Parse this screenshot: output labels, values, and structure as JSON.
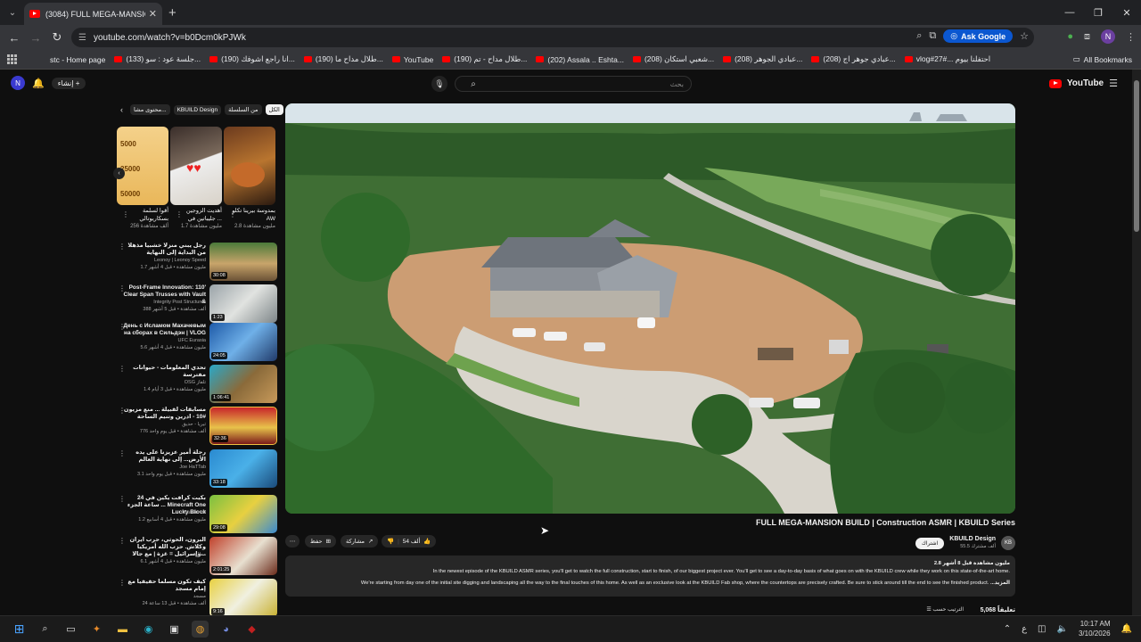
{
  "browser": {
    "tab_title": "(3084) FULL MEGA-MANSION B",
    "url": "youtube.com/watch?v=b0Dcm0kPJWk",
    "ask_google": "Ask Google",
    "profile_initial": "N"
  },
  "bookmarks": {
    "items": [
      "stc - Home page",
      "(133) جلسة عود : سو...",
      "(190) انا راجع اشوفك...",
      "(190) طلال مداح ما...",
      "YouTube",
      "(190) طلال مداح - تم...",
      "(202) Assala .. Eshta...",
      "(208) شعبي استكان...",
      "(208) عبادي الجوهر...",
      "(208) عبادي جوهر اج...",
      "vlog#27#... احتفلنا بيوم"
    ],
    "all": "All Bookmarks"
  },
  "youtube": {
    "create": "إنشاء",
    "search_placeholder": "بحث",
    "logo_text": "YouTube",
    "chips": [
      "الكل",
      "من السلسلة",
      "KBUILD Design",
      "محتوى مشا..."
    ],
    "shorts": [
      {
        "title": "بمدوسة بيرينا تكلو AW",
        "views": "2.8 مليون مشاهدة"
      },
      {
        "title": "أهديت الزوجين جليباتين في ...",
        "views": "1.7 مليون مشاهدة"
      },
      {
        "title": "أقوا لسلمة بسكاريوتالي",
        "views": "256 ألف مشاهدة"
      }
    ],
    "shorts_numbers": [
      "5000",
      "25000",
      "50000"
    ],
    "recommendations": [
      {
        "title": "رجل يبني منزلا خشبيا مذهلا من البداية إلى النهاية",
        "channel": "Leonoy | Leonoy Speed",
        "stats": "1.7 مليون مشاهدة • قبل 4 أشهر",
        "duration": "30:08"
      },
      {
        "title": "Post-Frame Innovation: 110' Clear Span Trusses with Vault &",
        "channel": "Integrity Post Structures",
        "stats": "388 ألف مشاهدة • قبل 5 أشهر",
        "duration": "1:23"
      },
      {
        "title": "День с Исламом Махачевым на сборах в Сильдэн | VLOG",
        "channel": "UFC Eurasia",
        "stats": "5.6 مليون مشاهدة • قبل 4 أشهر",
        "duration": "24:05"
      },
      {
        "title": "تحدي المعلومات - حيوانات مفترسة",
        "channel": "OSG تلفاز",
        "stats": "1.4 مليون مشاهدة • قبل 3 أيام",
        "duration": "1:06:41"
      },
      {
        "title": "مسابقات لقبيلة ... منع مزيون #10 - ادرين وتنيم الساحة",
        "channel": "تيريا - حديق",
        "stats": "776 ألف مشاهدة • قبل يوم واحد",
        "duration": "32:36"
      },
      {
        "title": "رحلة أمير عزيزنا على يده الأرض... إلى نهاية العالم",
        "channel": "Joe HaTTab",
        "stats": "3.1 مليون مشاهدة • قبل يوم واحد",
        "duration": "33:18"
      },
      {
        "title": "بكيت كرافت يكين في 24 ساعة الجزء ... Minecraft One Lucky Block",
        "channel": "Bandertoll",
        "stats": "1.2 مليون مشاهدة • قبل 4 أسابيع",
        "duration": "29:08"
      },
      {
        "title": "البرون، الحوثي، حرب ايران وكلاش. حزب الله أمريكيا وإسرائيل = غزة | مع جالا...",
        "channel": "مطلع",
        "stats": "6.1 مليون مشاهدة • قبل 4 أشهر",
        "duration": "2:01:25"
      },
      {
        "title": "كيف تكون مسلما حقيقيا مع إمام مسجد",
        "channel": "مسجد",
        "stats": "24 ألف مشاهدة • قبل 13 ساعة",
        "duration": "9:16"
      }
    ],
    "video": {
      "title": "FULL MEGA-MANSION BUILD | Construction ASMR | KBUILD Series",
      "channel": "KBUILD Design",
      "subscribers": "55.5 ألف مشترك",
      "channel_avatar": "KB",
      "subscribe": "اشتراك",
      "likes": "54 ألف",
      "share": "مشاركة",
      "save": "حفظ",
      "more": "⋯",
      "desc_meta": "2.8 مليون مشاهدة قبل 8 أشهر",
      "desc_line1": "In the newest episode of the KBUILD ASMR series, you'll get to watch the full construction, start to finish, of our biggest project ever. You'll get to see a day-to-day basis of what goes on with the KBUILD crew while they work on this state-of-the-art home.",
      "desc_line2": "We're starting from day one of the initial site digging and landscaping all the way to the final touches of this home. As well as an exclusive look at the KBUILD Fab shop, where the countertops are precisely crafted. Be sure to stick around till the end to see the finished product.",
      "desc_more": "...المزيد",
      "comments_count": "5,068 تعليقاً",
      "sort_label": "الترتيب حسب"
    }
  },
  "taskbar": {
    "time": "10:17 AM",
    "date": "3/10/2026",
    "lang": "ع"
  },
  "colors": {
    "accent": "#ff0000",
    "bg": "#0f0f0f",
    "chip": "#272727"
  }
}
